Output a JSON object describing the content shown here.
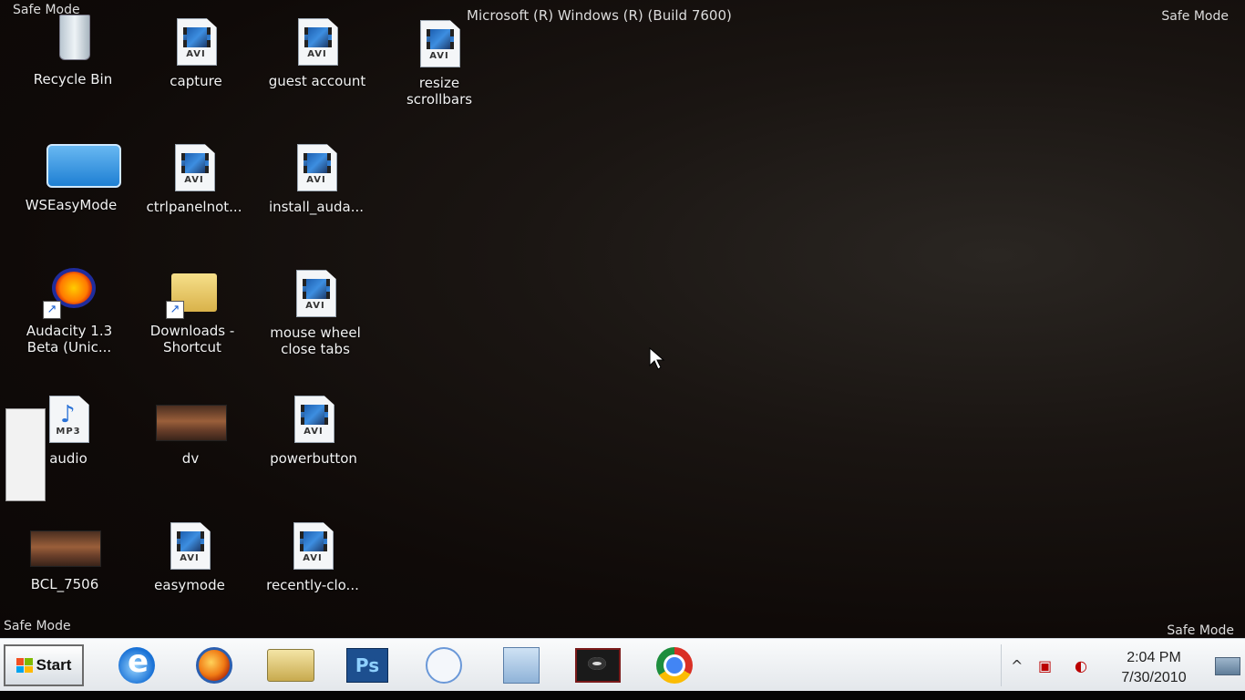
{
  "watermarks": {
    "top_left": "Safe Mode",
    "top_right": "Safe Mode",
    "bottom_left": "Safe Mode",
    "bottom_right": "Safe Mode",
    "title": "Microsoft (R) Windows (R) (Build 7600)"
  },
  "desktop_icons": {
    "recycle_bin": "Recycle Bin",
    "capture": "capture",
    "guest_account": "guest account",
    "resize_scrollbars_1": "resize",
    "resize_scrollbars_2": "scrollbars",
    "wseasymode": "WSEasyMode",
    "ctrlpanelnot": "ctrlpanelnot...",
    "install_auda": "install_auda...",
    "audacity_1": "Audacity 1.3",
    "audacity_2": "Beta (Unic...",
    "downloads_1": "Downloads -",
    "downloads_2": "Shortcut",
    "mouse_wheel_1": "mouse wheel",
    "mouse_wheel_2": "close tabs",
    "audio": "audio",
    "dv": "dv",
    "powerbutton": "powerbutton",
    "bcl": "BCL_7506",
    "easymode": "easymode",
    "recently_clo": "recently-clo..."
  },
  "file_ext": {
    "avi": "AVI",
    "mp3": "MP3"
  },
  "taskbar": {
    "start_label": "Start",
    "pinned": [
      "internet-explorer-icon",
      "firefox-icon",
      "windows-explorer-icon",
      "photoshop-icon",
      "remote-connection-icon",
      "calculator-icon",
      "eye-app-icon",
      "chrome-icon"
    ],
    "ps_label": "Ps"
  },
  "tray": {
    "time": "2:04 PM",
    "date": "7/30/2010",
    "expand_glyph": "^"
  }
}
